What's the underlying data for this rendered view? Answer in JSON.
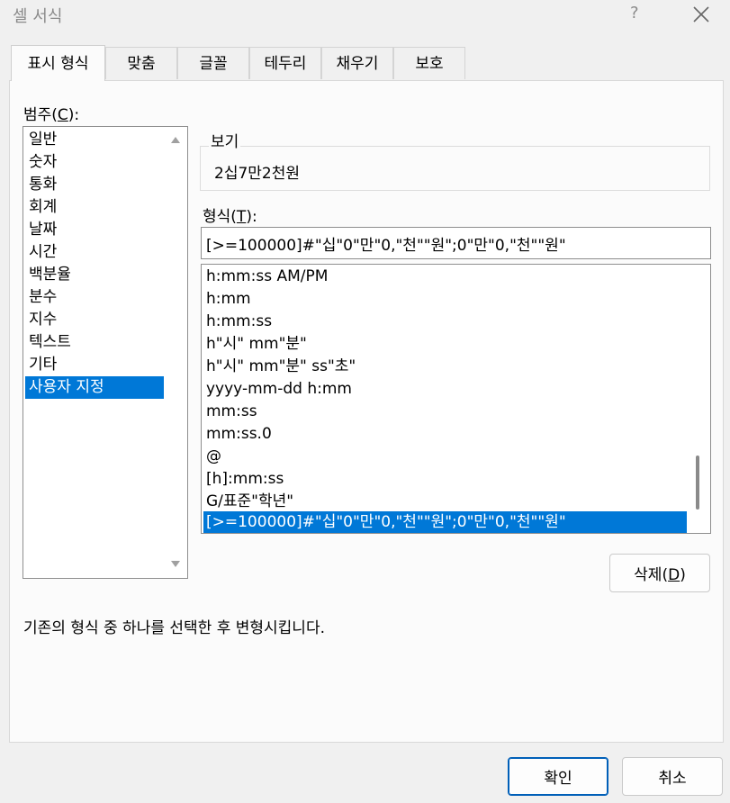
{
  "window": {
    "title": "셀 서식",
    "help_glyph": "?"
  },
  "tabs": [
    {
      "label": "표시 형식"
    },
    {
      "label": "맞춤"
    },
    {
      "label": "글꼴"
    },
    {
      "label": "테두리"
    },
    {
      "label": "채우기"
    },
    {
      "label": "보호"
    }
  ],
  "category": {
    "label": "범주(",
    "accel": "C",
    "label_tail": "):",
    "items": [
      "일반",
      "숫자",
      "통화",
      "회계",
      "날짜",
      "시간",
      "백분율",
      "분수",
      "지수",
      "텍스트",
      "기타",
      "사용자 지정"
    ],
    "selected": "사용자 지정"
  },
  "preview": {
    "label": "보기",
    "value": "2십7만2천원"
  },
  "format": {
    "label": "형식(",
    "accel": "T",
    "label_tail": "):",
    "value": "[>=100000]#\"십\"0\"만\"0,\"천\"\"원\";0\"만\"0,\"천\"\"원\"",
    "items": [
      "h:mm:ss AM/PM",
      "h:mm",
      "h:mm:ss",
      "h\"시\" mm\"분\"",
      "h\"시\" mm\"분\" ss\"초\"",
      "yyyy-mm-dd h:mm",
      "mm:ss",
      "mm:ss.0",
      "@",
      "[h]:mm:ss",
      "G/표준\"학년\"",
      "[>=100000]#\"십\"0\"만\"0,\"천\"\"원\";0\"만\"0,\"천\"\"원\""
    ]
  },
  "delete_button": {
    "label": "삭제(",
    "accel": "D",
    "label_tail": ")"
  },
  "description": "기존의 형식 중 하나를 선택한 후 변형시킵니다.",
  "ok_button": "확인",
  "cancel_button": "취소",
  "colors": {
    "selection": "#0078d7",
    "primary_border": "#005fb8"
  }
}
